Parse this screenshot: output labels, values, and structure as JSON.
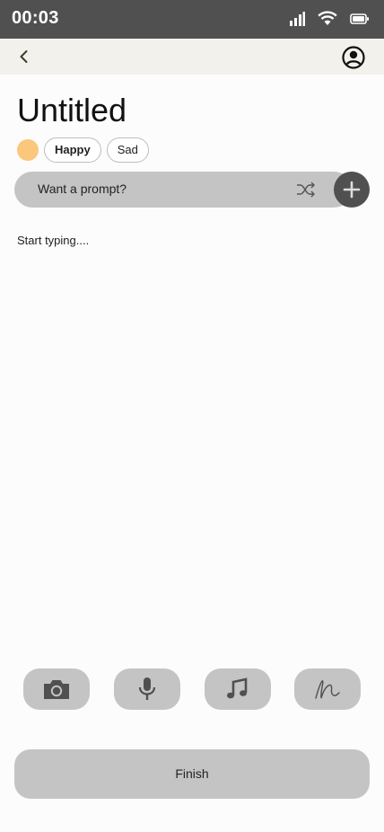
{
  "status_bar": {
    "time": "00:03",
    "icons": [
      "cellular-signal-icon",
      "wifi-icon",
      "battery-icon"
    ]
  },
  "nav": {
    "back_icon": "chevron-left-icon",
    "profile_icon": "account-circle-icon"
  },
  "entry": {
    "title": "Untitled",
    "body_placeholder": "Start typing...."
  },
  "mood": {
    "color": "#fbc77b",
    "chips": [
      {
        "label": "Happy",
        "selected": true
      },
      {
        "label": "Sad",
        "selected": false
      }
    ]
  },
  "prompt": {
    "label": "Want a prompt?",
    "shuffle_icon": "shuffle-icon",
    "add_icon": "plus-icon"
  },
  "toolbar": {
    "tools": [
      "camera-icon",
      "microphone-icon",
      "music-note-icon",
      "draw-icon"
    ]
  },
  "finish": {
    "label": "Finish"
  },
  "colors": {
    "status_bar": "#505050",
    "nav_bar": "#f2f1eb",
    "control": "#c4c4c4",
    "accent_dark": "#505050"
  }
}
